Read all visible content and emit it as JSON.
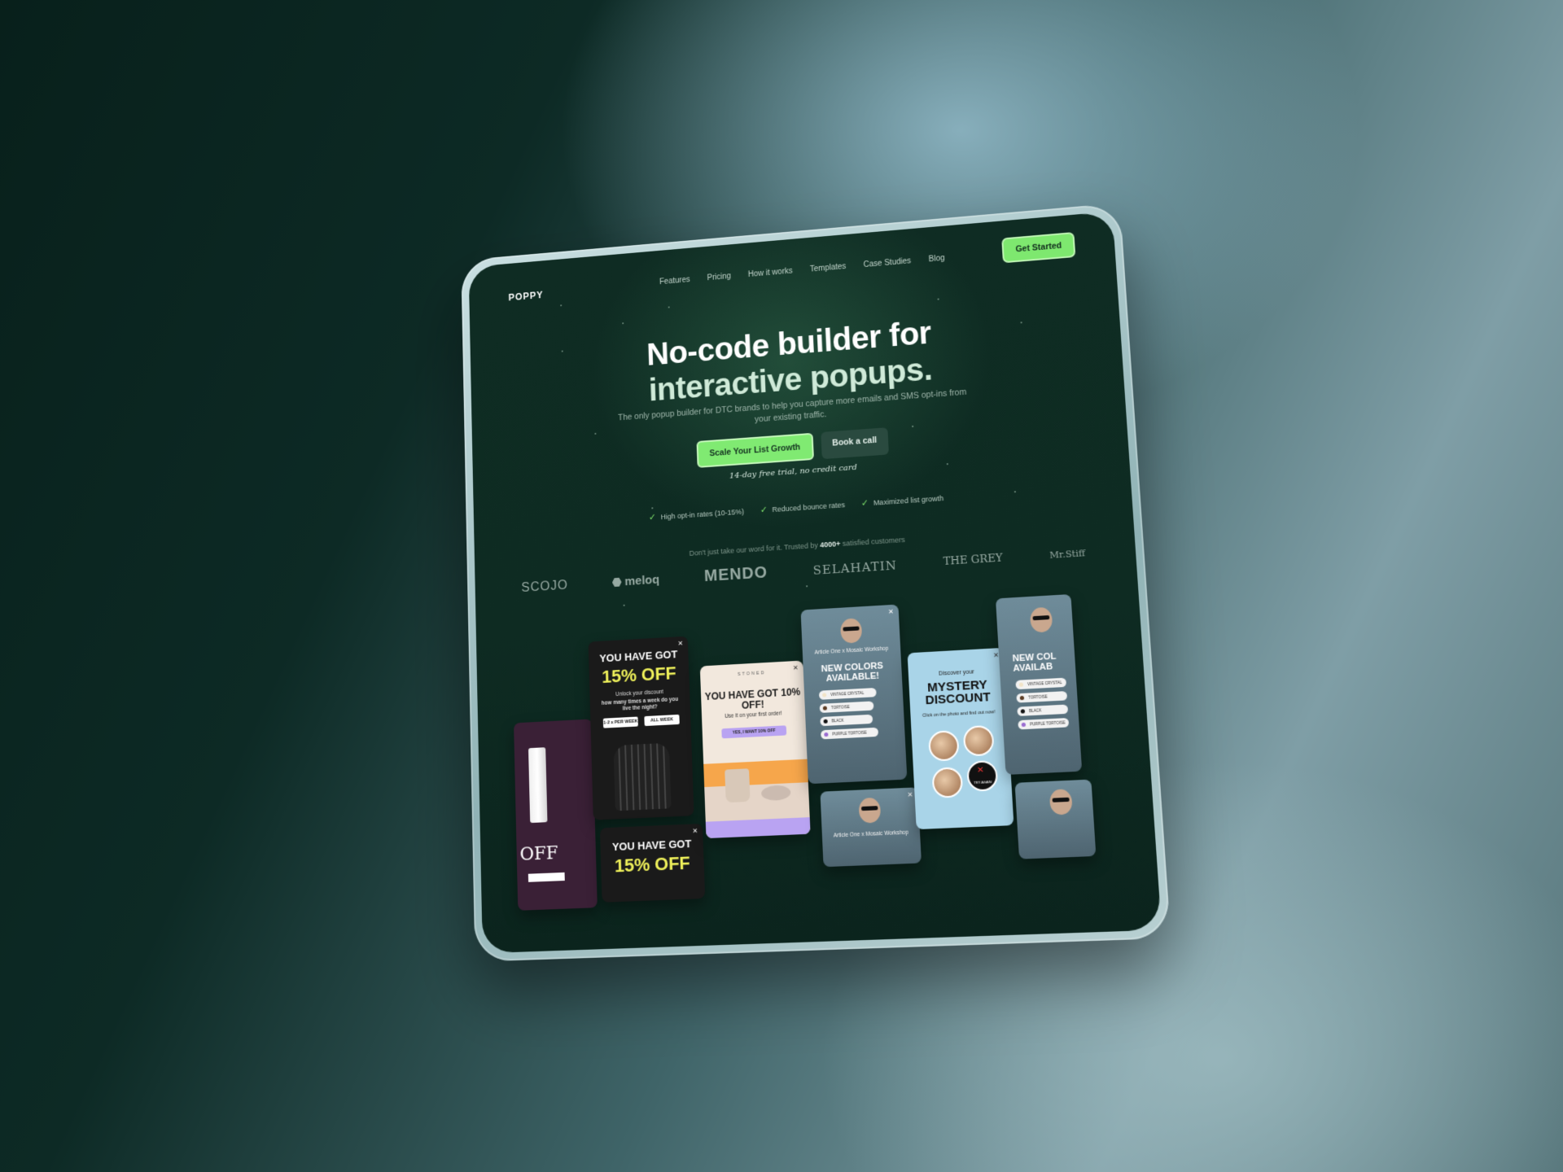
{
  "nav": {
    "logo": "POPPY",
    "items": [
      "Features",
      "Pricing",
      "How it works",
      "Templates",
      "Case Studies",
      "Blog"
    ],
    "cta": "Get Started"
  },
  "hero": {
    "title_line1": "No-code builder for",
    "title_line2": "interactive popups.",
    "subtitle": "The only popup builder for DTC brands to help you capture more emails and SMS opt-ins from your existing traffic.",
    "primary_button": "Scale Your List Growth",
    "secondary_button": "Book a call",
    "trial_note": "14-day free trial, no credit card"
  },
  "benefits": [
    "High opt-in rates (10-15%)",
    "Reduced bounce rates",
    "Maximized list growth"
  ],
  "trust": {
    "prefix": "Don't just take our word for it. Trusted by",
    "count": "4000+",
    "suffix": "satisfied customers"
  },
  "brands": [
    "SCOJO",
    "meloq",
    "MENDO",
    "SELAHATIN",
    "THE GREY",
    "Mr.Stiff"
  ],
  "popups": {
    "purple_off": "OFF",
    "black_title": "YOU HAVE GOT",
    "black_percent": "15% OFF",
    "black_sub": "Unlock your discount",
    "black_question": "how many times a week do you live the night?",
    "black_opt1": "1-2 x PER WEEK",
    "black_opt2": "ALL WEEK",
    "cream_brand": "STONED",
    "cream_title": "YOU HAVE GOT 10% OFF!",
    "cream_sub": "Use it on your first order!",
    "cream_yes": "YES, I WANT 10% OFF",
    "man_caption": "Article One x Mosaic Workshop",
    "man_title": "NEW COLORS AVAILABLE!",
    "man_options": [
      "VINTAGE CRYSTAL",
      "TORTOISE",
      "BLACK",
      "PURPLE TORTOISE"
    ],
    "man_title_cut": "NEW COL AVAILAB",
    "blue_discover": "Discover your",
    "blue_title": "MYSTERY DISCOUNT",
    "blue_click": "Click on the photo and find out now!",
    "blue_try": "TRY AGAIN"
  }
}
